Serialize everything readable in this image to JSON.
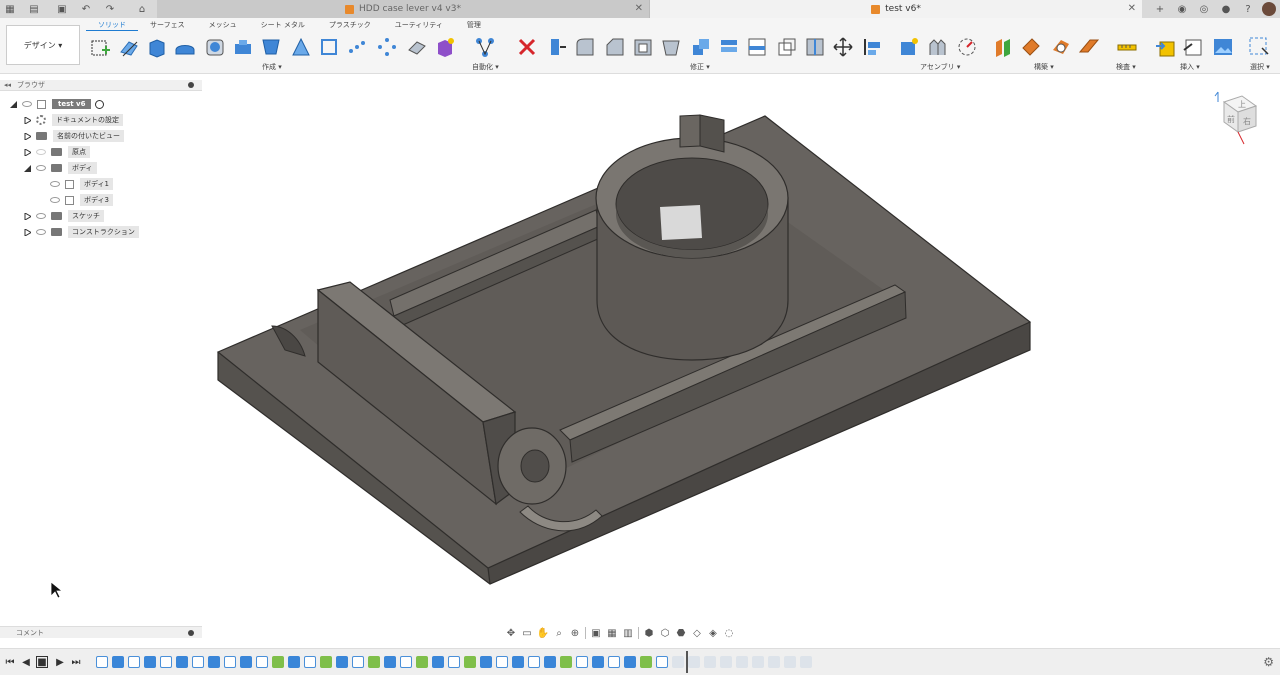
{
  "tabs": {
    "inactive_title": "HDD case lever v4 v3*",
    "active_title": "test v6*"
  },
  "ribbon": {
    "workspace_label": "デザイン ▾",
    "tabs": [
      "ソリッド",
      "サーフェス",
      "メッシュ",
      "シート メタル",
      "プラスチック",
      "ユーティリティ",
      "管理"
    ],
    "groups": {
      "create": "作成 ▾",
      "automate": "自動化 ▾",
      "modify": "修正 ▾",
      "assemble": "アセンブリ ▾",
      "construct": "構築 ▾",
      "inspect": "検査 ▾",
      "insert": "挿入 ▾",
      "select": "選択 ▾"
    }
  },
  "browser": {
    "title": "ブラウザ",
    "root": "test v6",
    "items": {
      "doc_settings": "ドキュメントの設定",
      "named_views": "名前の付いたビュー",
      "origin": "原点",
      "bodies": "ボディ",
      "body1": "ボディ1",
      "body3": "ボディ3",
      "sketches": "スケッチ",
      "construction": "コンストラクション"
    }
  },
  "comments": {
    "title": "コメント"
  },
  "viewcube": {
    "top": "上",
    "front": "前",
    "right": "右"
  },
  "colors": {
    "accent": "#1e7bd1",
    "model": "#66625d",
    "model_dark": "#4b4845",
    "model_light": "#807b76"
  }
}
